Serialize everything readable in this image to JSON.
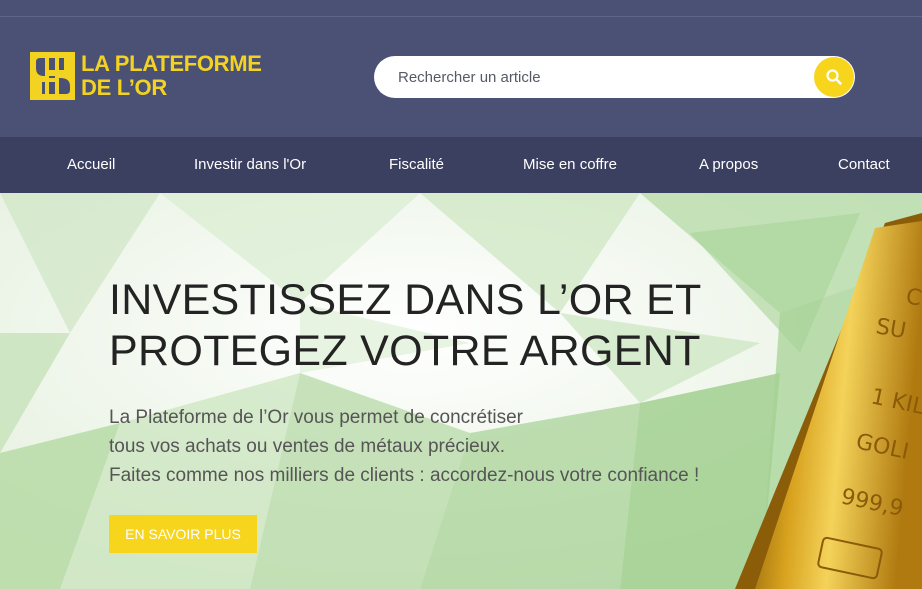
{
  "header": {
    "logo_line1": "LA PLATEFORME",
    "logo_line2": "DE L’OR",
    "search": {
      "placeholder": "Rechercher un article",
      "button_icon": "search-icon"
    }
  },
  "nav": {
    "items": [
      {
        "label": "Accueil"
      },
      {
        "label": "Investir dans l'Or"
      },
      {
        "label": "Fiscalité"
      },
      {
        "label": "Mise en coffre"
      },
      {
        "label": "A propos"
      },
      {
        "label": "Contact"
      }
    ]
  },
  "hero": {
    "title_line1": "INVESTISSEZ DANS L’OR ET",
    "title_line2": "PROTEGEZ VOTRE ARGENT",
    "text_lines": [
      "La Plateforme de l’Or vous permet de concrétiser",
      "tous vos achats ou ventes de métaux précieux.",
      "Faites comme nos milliers de clients : accordez-nous votre confiance !"
    ],
    "cta_label": "EN SAVOIR PLUS",
    "gold_bar_lines": [
      "C",
      "SU",
      "1 KIL",
      "GOLI",
      "999,9"
    ]
  },
  "colors": {
    "header_bg": "#4b5075",
    "nav_bg": "#3c4060",
    "accent_yellow": "#f7d51d",
    "logo_yellow": "#f2d321"
  }
}
